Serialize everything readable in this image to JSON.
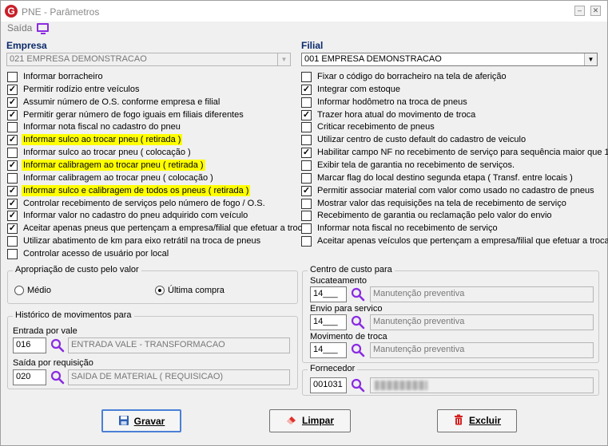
{
  "window": {
    "title": "PNE - Parâmetros",
    "logo_letter": "G",
    "minimize_glyph": "–",
    "close_glyph": "✕"
  },
  "menu": {
    "saida": "Saída",
    "monitor_icon": "monitor-icon"
  },
  "empresa": {
    "heading": "Empresa",
    "value": "021 EMPRESA DEMONSTRACAO"
  },
  "filial": {
    "heading": "Filial",
    "value": "001 EMPRESA DEMONSTRACAO"
  },
  "checks_left": [
    {
      "label": "Informar borracheiro",
      "checked": false,
      "highlight": false
    },
    {
      "label": "Permitir rodízio entre veículos",
      "checked": true,
      "highlight": false
    },
    {
      "label": "Assumir número de O.S. conforme empresa e filial",
      "checked": true,
      "highlight": false
    },
    {
      "label": "Permitir gerar número de fogo iguais em filiais diferentes",
      "checked": true,
      "highlight": false
    },
    {
      "label": "Informar nota fiscal no cadastro do pneu",
      "checked": false,
      "highlight": false
    },
    {
      "label": "Informar sulco ao trocar pneu ( retirada )",
      "checked": true,
      "highlight": true
    },
    {
      "label": "Informar sulco ao trocar pneu ( colocação )",
      "checked": false,
      "highlight": false
    },
    {
      "label": "Informar calibragem ao trocar pneu ( retirada )",
      "checked": true,
      "highlight": true
    },
    {
      "label": "Informar calibragem ao trocar pneu ( colocação )",
      "checked": false,
      "highlight": false
    },
    {
      "label": "Informar sulco e calibragem de todos os pneus ( retirada )",
      "checked": true,
      "highlight": true
    },
    {
      "label": "Controlar recebimento de serviços pelo número de fogo / O.S.",
      "checked": true,
      "highlight": false
    },
    {
      "label": "Informar valor no cadastro do pneu adquirido com veículo",
      "checked": true,
      "highlight": false
    },
    {
      "label": "Aceitar apenas pneus que pertençam a empresa/filial que efetuar a troca",
      "checked": true,
      "highlight": false
    },
    {
      "label": "Utilizar abatimento de km para eixo retrátil na troca de pneus",
      "checked": false,
      "highlight": false
    },
    {
      "label": "Controlar acesso de usuário por local",
      "checked": false,
      "highlight": false
    }
  ],
  "checks_right": [
    {
      "label": "Fixar o código do borracheiro na tela de aferição",
      "checked": false
    },
    {
      "label": "Integrar com estoque",
      "checked": true
    },
    {
      "label": "Informar hodômetro na troca de pneus",
      "checked": false
    },
    {
      "label": "Trazer hora atual do movimento de troca",
      "checked": true
    },
    {
      "label": "Criticar recebimento de pneus",
      "checked": false
    },
    {
      "label": "Utilizar centro de custo default do cadastro de veiculo",
      "checked": false
    },
    {
      "label": "Habilitar campo NF no recebimento de serviço para sequência maior que 1",
      "checked": true
    },
    {
      "label": "Exibir tela de garantia no recebimento de serviços.",
      "checked": false
    },
    {
      "label": "Marcar flag do local destino segunda etapa ( Transf. entre locais )",
      "checked": false
    },
    {
      "label": "Permitir associar material com valor como usado no cadastro de pneus",
      "checked": true
    },
    {
      "label": "Mostrar valor das requisições na tela de recebimento de serviço",
      "checked": false
    },
    {
      "label": "Recebimento de garantia ou reclamação pelo valor do envio",
      "checked": false
    },
    {
      "label": "Informar nota fiscal no recebimento de serviço",
      "checked": false
    },
    {
      "label": "Aceitar apenas veículos que pertençam a empresa/filial que efetuar a troca",
      "checked": false
    }
  ],
  "apropriacao": {
    "title": "Apropriação de custo pelo valor",
    "opt_medio": "Médio",
    "opt_ultima": "Última compra",
    "selected": "Última compra"
  },
  "historico": {
    "title": "Histórico de movimentos para",
    "entrada_label": "Entrada por vale",
    "entrada_code": "016",
    "entrada_desc": "ENTRADA VALE - TRANSFORMACAO",
    "saida_label": "Saída por requisição",
    "saida_code": "020",
    "saida_desc": "SAIDA DE MATERIAL ( REQUISICAO)"
  },
  "centro_custo": {
    "title": "Centro de custo para",
    "sucateamento_label": "Sucateamento",
    "sucateamento_code": "14___",
    "sucateamento_desc": "Manutenção preventiva",
    "envio_label": "Envio para servico",
    "envio_code": "14___",
    "envio_desc": "Manutenção preventiva",
    "movimento_label": "Movimento de troca",
    "movimento_code": "14___",
    "movimento_desc": "Manutenção preventiva"
  },
  "fornecedor": {
    "title": "Fornecedor",
    "code": "001031"
  },
  "buttons": {
    "gravar": "Gravar",
    "limpar": "Limpar",
    "excluir": "Excluir"
  },
  "colors": {
    "highlight": "#ffff00",
    "heading": "#0b2a6b",
    "search_icon": "#8a2be2"
  }
}
